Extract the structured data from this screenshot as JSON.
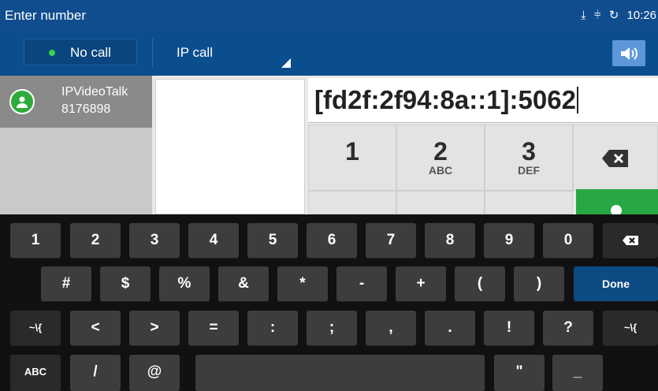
{
  "status_bar": {
    "title": "Enter number",
    "time": "10:26"
  },
  "call_bar": {
    "line_status": "No call",
    "call_type": "IP call"
  },
  "contact": {
    "name": "IPVideoTalk",
    "number": "8176898"
  },
  "number_field": {
    "value": "[fd2f:2f94:8a::1]:5062"
  },
  "dialpad": {
    "keys": [
      {
        "digit": "1",
        "letters": ""
      },
      {
        "digit": "2",
        "letters": "ABC"
      },
      {
        "digit": "3",
        "letters": "DEF"
      }
    ]
  },
  "keyboard": {
    "row1": [
      "1",
      "2",
      "3",
      "4",
      "5",
      "6",
      "7",
      "8",
      "9",
      "0"
    ],
    "row2": [
      "#",
      "$",
      "%",
      "&",
      "*",
      "-",
      "+",
      "(",
      ")"
    ],
    "done_label": "Done",
    "row3": [
      "~\\{",
      "<",
      ">",
      "=",
      ":",
      ";",
      ",",
      ".",
      "!",
      "?",
      "~\\{"
    ],
    "row4": {
      "abc": "ABC",
      "slash": "/",
      "at": "@",
      "quote": "\"",
      "underscore": "_"
    }
  },
  "colors": {
    "header": "#0f4d8f",
    "call_green": "#28a745",
    "done_blue": "#0c4b83"
  }
}
